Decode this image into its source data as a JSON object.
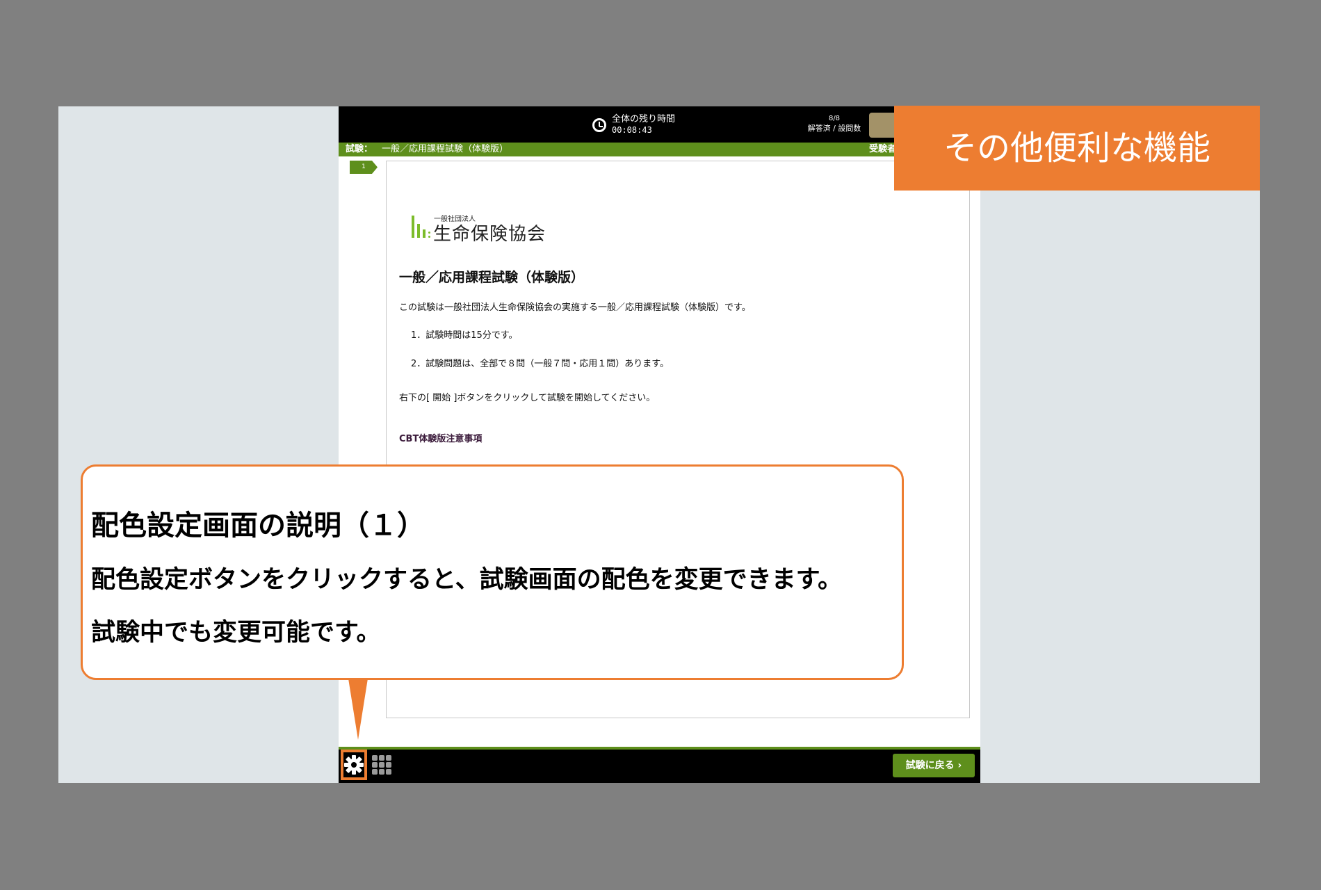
{
  "exam_window": {
    "timer": {
      "icon": "clock-icon",
      "label": "全体の残り時間",
      "value": "00:08:43"
    },
    "progress": {
      "count": "8/8",
      "label": "解答済 / 設問数"
    },
    "exam_info": {
      "label": "試験：",
      "name": "一般／応用課程試験（体験版）",
      "right_label": "受験者"
    },
    "question_tab": "1",
    "content": {
      "logo_sub": "一般社団法人",
      "logo_main": "生命保険協会",
      "title": "一般／応用課程試験（体験版）",
      "intro": "この試験は一般社団法人生命保険協会の実施する一般／応用課程試験（体験版）です。",
      "items": [
        "1．試験時間は15分です。",
        "2．試験問題は、全部で８問（一般７問・応用１問）あります。"
      ],
      "instruction": "右下の[ 開始 ]ボタンをクリックして試験を開始してください。",
      "notes_heading": "CBT体験版注意事項"
    },
    "bottom": {
      "settings_icon": "gear-icon",
      "grid_icon": "grid-icon",
      "back_button": "試験に戻る",
      "back_icon": "chevron-right-icon"
    }
  },
  "header_banner": "その他便利な機能",
  "callout": {
    "title": "配色設定画面の説明（１）",
    "line1": "配色設定ボタンをクリックすると、試験画面の配色を変更できます。",
    "line2": "試験中でも変更可能です。"
  },
  "colors": {
    "accent_orange": "#ed7d31",
    "exam_green": "#5e8f1c",
    "logo_green": "#7cbc2b"
  }
}
